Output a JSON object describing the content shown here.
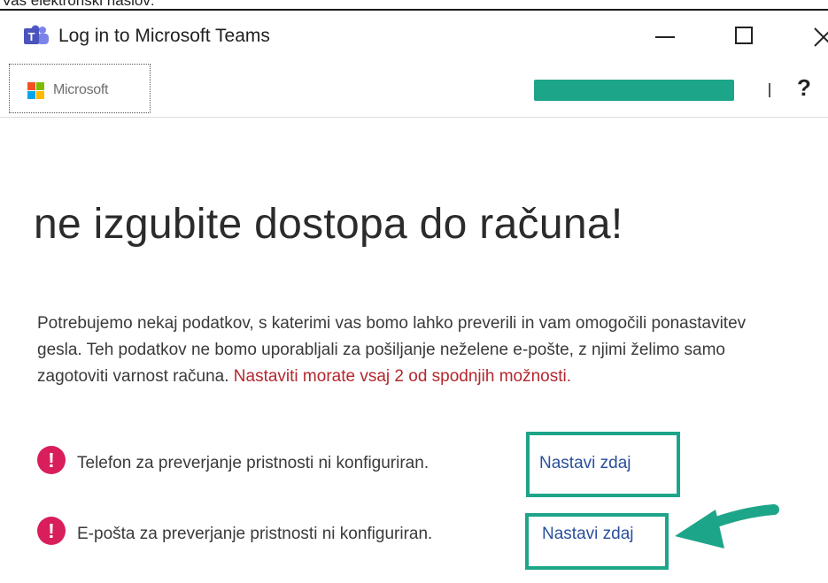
{
  "caption": "Vaš elektronski naslov:",
  "window": {
    "title": "Log in to Microsoft Teams",
    "icon": "microsoft-teams-icon",
    "controls": [
      "minimize",
      "maximize",
      "close"
    ]
  },
  "toolbar": {
    "brand": "Microsoft",
    "help": "?"
  },
  "main": {
    "heading": "ne izgubite dostopa do računa!",
    "intro": "Potrebujemo nekaj podatkov, s katerimi vas bomo lahko preverili in vam omogočili ponastavitev gesla. Teh podatkov ne bomo uporabljali za pošiljanje neželene e-pošte, z njimi želimo samo zagotoviti varnost računa.",
    "warning": "Nastaviti morate vsaj 2 od spodnjih možnosti."
  },
  "methods": [
    {
      "text": "Telefon za preverjanje pristnosti ni konfiguriran.",
      "action": "Nastavi zdaj"
    },
    {
      "text": "E-pošta za preverjanje pristnosti ni konfiguriran.",
      "action": "Nastavi zdaj"
    }
  ],
  "colors": {
    "highlight": "#1da58a",
    "warning": "#b3272d",
    "alert": "#d81e5b",
    "link": "#2a4f9c"
  }
}
